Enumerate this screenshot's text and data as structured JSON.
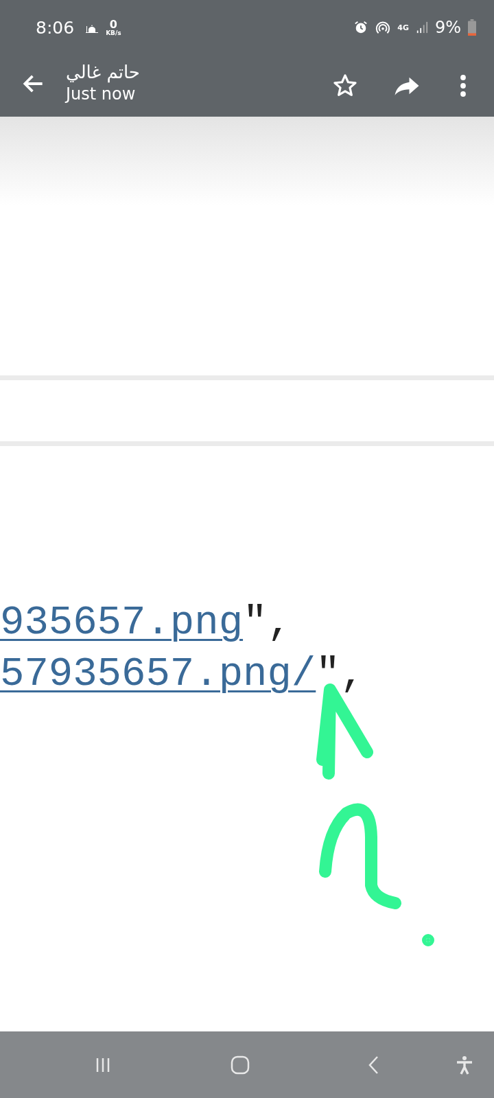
{
  "status_bar": {
    "time": "8:06",
    "speed_value": "0",
    "speed_unit": "KB/s",
    "network": "4G",
    "battery": "9%"
  },
  "header": {
    "title": "حاتم غالي",
    "subtitle": "Just now"
  },
  "code_lines": [
    {
      "link": "935657.png",
      "suffix": "\","
    },
    {
      "link": "57935657.png/",
      "suffix": "\","
    }
  ]
}
